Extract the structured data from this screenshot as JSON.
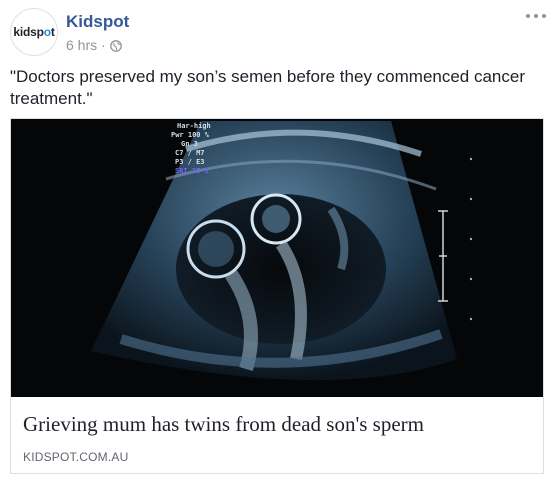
{
  "post": {
    "page_name": "Kidspot",
    "avatar_text_pre": "kidsp",
    "avatar_text_o": "o",
    "avatar_text_post": "t",
    "time": "6 hrs",
    "separator": "·",
    "privacy_icon": "globe-icon",
    "more_icon": "ellipsis-icon",
    "caption": "\"Doctors preserved my son’s semen before they commenced cancer treatment.\""
  },
  "link_card": {
    "image_overlay": {
      "lines": [
        "Har-high",
        "Pwr 100 %",
        "Gn  3",
        "C7 / M7",
        "P3 / E3",
        "SRI II 3"
      ],
      "highlight_color": "#7b5cff"
    },
    "title": "Grieving mum has twins from dead son's sperm",
    "domain": "KIDSPOT.COM.AU"
  },
  "colors": {
    "page_name": "#365899",
    "meta": "#90949c",
    "avatar_accent": "#2b8fd6"
  }
}
